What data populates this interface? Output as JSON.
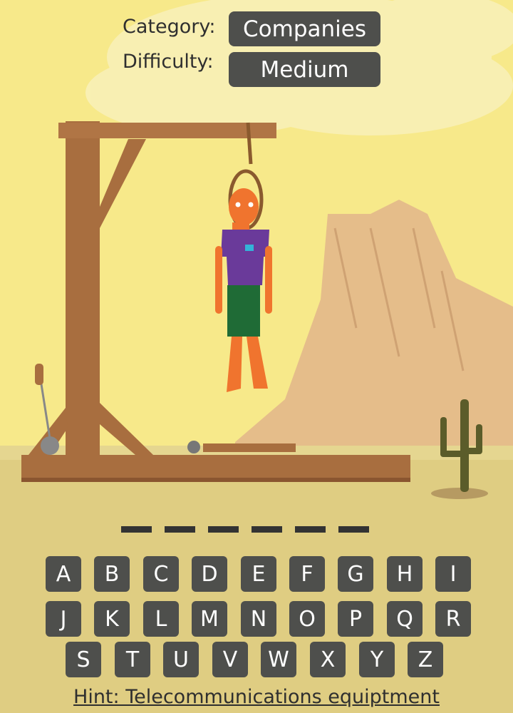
{
  "header": {
    "category_label": "Category:",
    "category_value": "Companies",
    "difficulty_label": "Difficulty:",
    "difficulty_value": "Medium"
  },
  "word": {
    "blanks": [
      "",
      "",
      "",
      "",
      "",
      ""
    ]
  },
  "keyboard": {
    "rows": [
      [
        "A",
        "B",
        "C",
        "D",
        "E",
        "F",
        "G",
        "H",
        "I"
      ],
      [
        "J",
        "K",
        "L",
        "M",
        "N",
        "O",
        "P",
        "Q",
        "R"
      ],
      [
        "S",
        "T",
        "U",
        "V",
        "W",
        "X",
        "Y",
        "Z"
      ]
    ]
  },
  "hint": {
    "text": "Hint: Telecommunications equiptment"
  },
  "colors": {
    "sky": "#f7e98a",
    "ground": "#dfcd82",
    "key_bg": "#4e4f4c",
    "wood": "#a86e3f",
    "shirt": "#6a3a9a",
    "pants": "#1f6b36",
    "skin": "#f0742e"
  }
}
